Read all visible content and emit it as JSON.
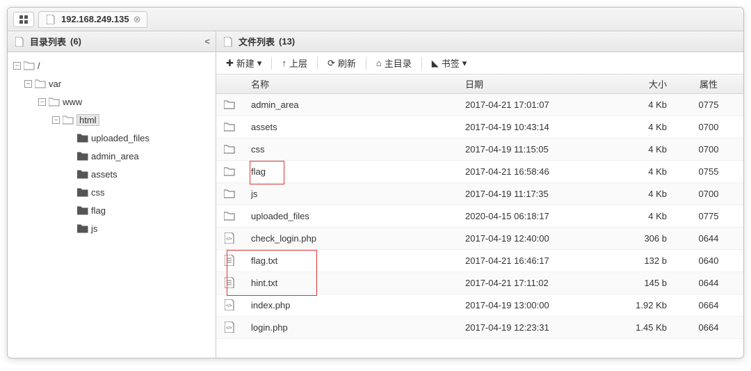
{
  "tab": {
    "ip": "192.168.249.135"
  },
  "left_panel": {
    "title": "目录列表",
    "count": "(6)"
  },
  "right_panel": {
    "title": "文件列表",
    "count": "(13)"
  },
  "toolbar": {
    "new": "新建",
    "up": "上层",
    "refresh": "刷新",
    "home": "主目录",
    "bookmark": "书签"
  },
  "columns": {
    "name": "名称",
    "date": "日期",
    "size": "大小",
    "attr": "属性"
  },
  "tree": {
    "root": "/",
    "n1": "var",
    "n2": "www",
    "n3": "html",
    "c1": "uploaded_files",
    "c2": "admin_area",
    "c3": "assets",
    "c4": "css",
    "c5": "flag",
    "c6": "js"
  },
  "files": [
    {
      "icon": "folder",
      "name": "admin_area",
      "date": "2017-04-21 17:01:07",
      "size": "4 Kb",
      "attr": "0775"
    },
    {
      "icon": "folder",
      "name": "assets",
      "date": "2017-04-19 10:43:14",
      "size": "4 Kb",
      "attr": "0700"
    },
    {
      "icon": "folder",
      "name": "css",
      "date": "2017-04-19 11:15:05",
      "size": "4 Kb",
      "attr": "0700"
    },
    {
      "icon": "folder",
      "name": "flag",
      "date": "2017-04-21 16:58:46",
      "size": "4 Kb",
      "attr": "0755"
    },
    {
      "icon": "folder",
      "name": "js",
      "date": "2017-04-19 11:17:35",
      "size": "4 Kb",
      "attr": "0700"
    },
    {
      "icon": "folder",
      "name": "uploaded_files",
      "date": "2020-04-15 06:18:17",
      "size": "4 Kb",
      "attr": "0775"
    },
    {
      "icon": "php",
      "name": "check_login.php",
      "date": "2017-04-19 12:40:00",
      "size": "306 b",
      "attr": "0644"
    },
    {
      "icon": "txt",
      "name": "flag.txt",
      "date": "2017-04-21 16:46:17",
      "size": "132 b",
      "attr": "0640"
    },
    {
      "icon": "txt",
      "name": "hint.txt",
      "date": "2017-04-21 17:11:02",
      "size": "145 b",
      "attr": "0644"
    },
    {
      "icon": "php",
      "name": "index.php",
      "date": "2017-04-19 13:00:00",
      "size": "1.92 Kb",
      "attr": "0664"
    },
    {
      "icon": "php",
      "name": "login.php",
      "date": "2017-04-19 12:23:31",
      "size": "1.45 Kb",
      "attr": "0664"
    }
  ],
  "highlights": [
    {
      "target": "cell-name-flag"
    },
    {
      "target": "cell-name-flag.txt-hint.txt"
    }
  ]
}
